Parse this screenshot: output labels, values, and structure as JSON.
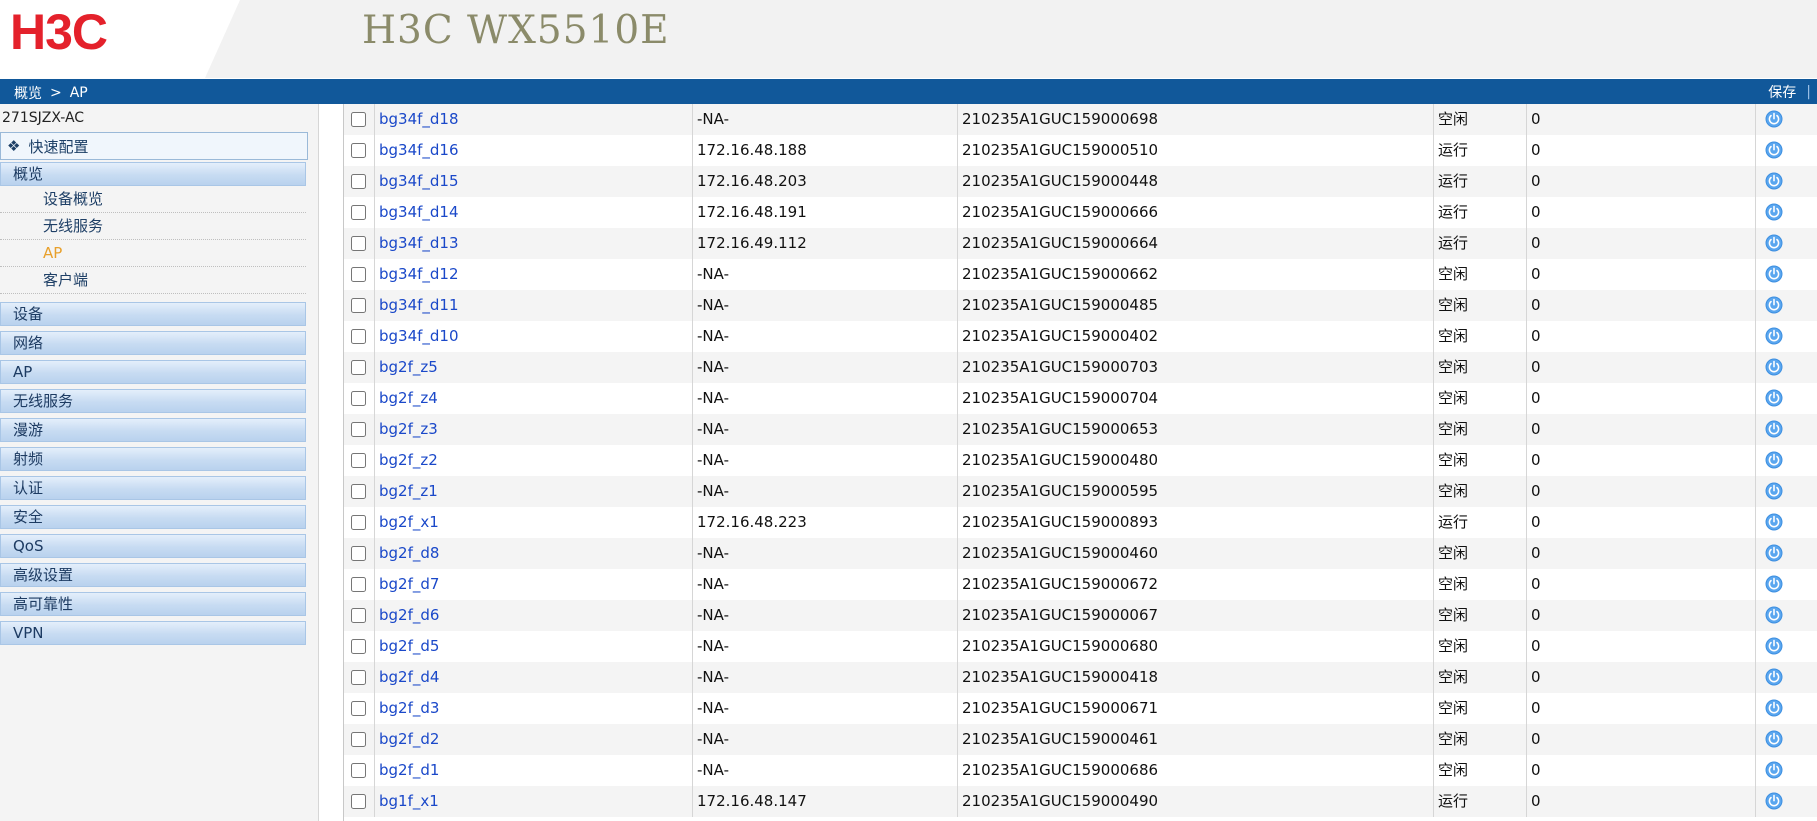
{
  "header": {
    "logo_text": "H3C",
    "product_title": "H3C WX5510E",
    "brand_color": "#e4212b"
  },
  "topbar": {
    "breadcrumb": [
      "概览",
      "AP"
    ],
    "breadcrumb_separator": ">",
    "save_label": "保存",
    "separator": "|",
    "bar_color": "#11589a"
  },
  "sidebar": {
    "device_name": "271SJZX-AC",
    "quick_config": {
      "label": "快速配置",
      "icon": "diamond-bullet-icon"
    },
    "overview": {
      "label": "概览",
      "items": [
        {
          "label": "设备概览",
          "active": false
        },
        {
          "label": "无线服务",
          "active": false
        },
        {
          "label": "AP",
          "active": true
        },
        {
          "label": "客户端",
          "active": false
        }
      ]
    },
    "groups": [
      "设备",
      "网络",
      "AP",
      "无线服务",
      "漫游",
      "射频",
      "认证",
      "安全",
      "QoS",
      "高级设置",
      "高可靠性",
      "VPN"
    ]
  },
  "table": {
    "operation_icon": "power-icon",
    "rows": [
      {
        "name": "bg34f_d18",
        "ip": "-NA-",
        "serial": "210235A1GUC159000698",
        "status": "空闲",
        "count": "0"
      },
      {
        "name": "bg34f_d16",
        "ip": "172.16.48.188",
        "serial": "210235A1GUC159000510",
        "status": "运行",
        "count": "0"
      },
      {
        "name": "bg34f_d15",
        "ip": "172.16.48.203",
        "serial": "210235A1GUC159000448",
        "status": "运行",
        "count": "0"
      },
      {
        "name": "bg34f_d14",
        "ip": "172.16.48.191",
        "serial": "210235A1GUC159000666",
        "status": "运行",
        "count": "0"
      },
      {
        "name": "bg34f_d13",
        "ip": "172.16.49.112",
        "serial": "210235A1GUC159000664",
        "status": "运行",
        "count": "0"
      },
      {
        "name": "bg34f_d12",
        "ip": "-NA-",
        "serial": "210235A1GUC159000662",
        "status": "空闲",
        "count": "0"
      },
      {
        "name": "bg34f_d11",
        "ip": "-NA-",
        "serial": "210235A1GUC159000485",
        "status": "空闲",
        "count": "0"
      },
      {
        "name": "bg34f_d10",
        "ip": "-NA-",
        "serial": "210235A1GUC159000402",
        "status": "空闲",
        "count": "0"
      },
      {
        "name": "bg2f_z5",
        "ip": "-NA-",
        "serial": "210235A1GUC159000703",
        "status": "空闲",
        "count": "0"
      },
      {
        "name": "bg2f_z4",
        "ip": "-NA-",
        "serial": "210235A1GUC159000704",
        "status": "空闲",
        "count": "0"
      },
      {
        "name": "bg2f_z3",
        "ip": "-NA-",
        "serial": "210235A1GUC159000653",
        "status": "空闲",
        "count": "0"
      },
      {
        "name": "bg2f_z2",
        "ip": "-NA-",
        "serial": "210235A1GUC159000480",
        "status": "空闲",
        "count": "0"
      },
      {
        "name": "bg2f_z1",
        "ip": "-NA-",
        "serial": "210235A1GUC159000595",
        "status": "空闲",
        "count": "0"
      },
      {
        "name": "bg2f_x1",
        "ip": "172.16.48.223",
        "serial": "210235A1GUC159000893",
        "status": "运行",
        "count": "0"
      },
      {
        "name": "bg2f_d8",
        "ip": "-NA-",
        "serial": "210235A1GUC159000460",
        "status": "空闲",
        "count": "0"
      },
      {
        "name": "bg2f_d7",
        "ip": "-NA-",
        "serial": "210235A1GUC159000672",
        "status": "空闲",
        "count": "0"
      },
      {
        "name": "bg2f_d6",
        "ip": "-NA-",
        "serial": "210235A1GUC159000067",
        "status": "空闲",
        "count": "0"
      },
      {
        "name": "bg2f_d5",
        "ip": "-NA-",
        "serial": "210235A1GUC159000680",
        "status": "空闲",
        "count": "0"
      },
      {
        "name": "bg2f_d4",
        "ip": "-NA-",
        "serial": "210235A1GUC159000418",
        "status": "空闲",
        "count": "0"
      },
      {
        "name": "bg2f_d3",
        "ip": "-NA-",
        "serial": "210235A1GUC159000671",
        "status": "空闲",
        "count": "0"
      },
      {
        "name": "bg2f_d2",
        "ip": "-NA-",
        "serial": "210235A1GUC159000461",
        "status": "空闲",
        "count": "0"
      },
      {
        "name": "bg2f_d1",
        "ip": "-NA-",
        "serial": "210235A1GUC159000686",
        "status": "空闲",
        "count": "0"
      },
      {
        "name": "bg1f_x1",
        "ip": "172.16.48.147",
        "serial": "210235A1GUC159000490",
        "status": "运行",
        "count": "0"
      }
    ]
  }
}
